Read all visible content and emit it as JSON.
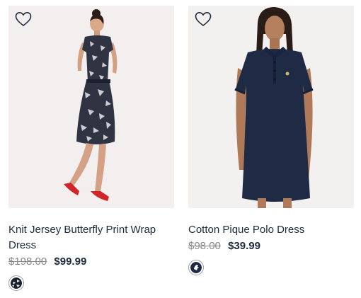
{
  "products": [
    {
      "title": "Knit Jersey Butterfly Print Wrap Dress",
      "original_price": "$198.00",
      "sale_price": "$99.99",
      "wishlist_icon": "heart-outline-icon",
      "swatch_colors": [
        "#1b1f2e",
        "#e9e9ee"
      ]
    },
    {
      "title": "Cotton Pique Polo Dress",
      "original_price": "$98.00",
      "sale_price": "$39.99",
      "wishlist_icon": "heart-outline-icon",
      "swatch_colors": [
        "#1e2a44",
        "#ffffff"
      ]
    }
  ]
}
